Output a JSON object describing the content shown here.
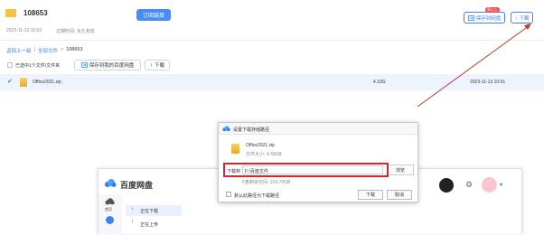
{
  "share": {
    "folder_name": "108653",
    "subscribe_label": "订阅链接",
    "date": "2023-11-13 10:02",
    "expire_label": "过期时间: 永久有效",
    "save_label": "保存到网盘",
    "save_badge": "原以上",
    "download_label": "下载"
  },
  "breadcrumb": {
    "back": "返回上一级",
    "sep1": "|",
    "all_files": "全部文件",
    "sep2": ">",
    "current": "108653"
  },
  "selection": {
    "selected_text": "已选中1个文件/文件夹",
    "save_mine_label": "保存到我的百度网盘",
    "download_label": "下载"
  },
  "file_row": {
    "name": "Office2021.zip",
    "size": "4.33G",
    "date": "2023-11-13 10:01"
  },
  "dialog": {
    "title": "设置下载存储路径",
    "file_name": "Office2021.zip",
    "file_size_label": "文件大小: 4.33GB",
    "path_label": "下载到",
    "path_value": "F:\\百度文件",
    "browse_label": "浏览",
    "free_space": "F盘剩余空间: 219.70GB",
    "default_checkbox_label": "默认此路径为下载路径",
    "download_label": "下载",
    "cancel_label": "取消"
  },
  "client": {
    "app_title": "百度网盘",
    "nav_home": "首页",
    "downloading": "正在下载",
    "uploading": "正在上传"
  },
  "colors": {
    "accent": "#4a8cf7",
    "highlight": "#d8262f",
    "arrow": "#c0392b"
  }
}
